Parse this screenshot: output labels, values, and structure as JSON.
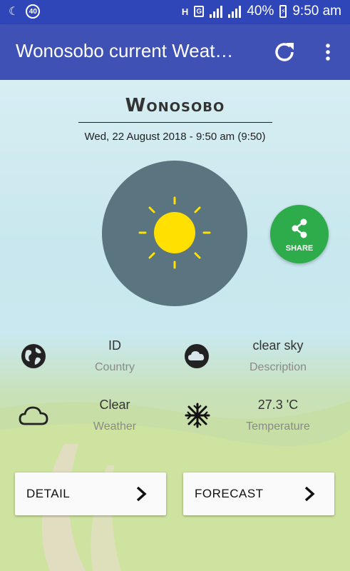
{
  "status_bar": {
    "signal_label": "H",
    "sim_label": "G",
    "battery_percent": "40%",
    "time": "9:50 am",
    "notification_count": "40"
  },
  "app_bar": {
    "title": "Wonosobo current Weat…"
  },
  "weather": {
    "city": "Wonosobo",
    "datetime": "Wed, 22 August 2018 - 9:50 am (9:50)",
    "icon": "sun-icon",
    "share_label": "SHARE"
  },
  "info": {
    "country_value": "ID",
    "country_label": "Country",
    "description_value": "clear sky",
    "description_label": "Description",
    "weather_value": "Clear",
    "weather_label": "Weather",
    "temperature_value": "27.3 'C",
    "temperature_label": "Temperature"
  },
  "buttons": {
    "detail_label": "DETAIL",
    "forecast_label": "FORECAST"
  },
  "colors": {
    "status_bar": "#2f46b8",
    "app_bar": "#3f51b5",
    "circle": "#5a7580",
    "sun": "#ffe000",
    "share": "#2eab4a"
  }
}
